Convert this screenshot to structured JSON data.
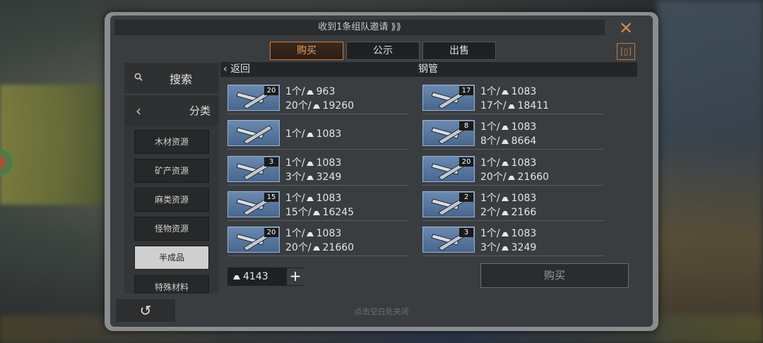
{
  "header": {
    "notification": "收到1条组队邀请 ⟫⟫",
    "close_icon": "✕"
  },
  "tabs": [
    {
      "label": "购买",
      "active": true
    },
    {
      "label": "公示",
      "active": false
    },
    {
      "label": "出售",
      "active": false
    }
  ],
  "sidebar": {
    "search_label": "搜索",
    "category_label": "分类",
    "categories": [
      {
        "label": "木材资源",
        "active": false
      },
      {
        "label": "矿产资源",
        "active": false
      },
      {
        "label": "麻类资源",
        "active": false
      },
      {
        "label": "怪物资源",
        "active": false
      },
      {
        "label": "半成品",
        "active": true
      },
      {
        "label": "特殊材料",
        "active": false
      }
    ]
  },
  "content": {
    "back_label": "返回",
    "title": "钢管"
  },
  "listings": [
    {
      "badge": "20",
      "unit": "1个/",
      "unit_price": "963",
      "qty": "20个/",
      "total": "19260"
    },
    {
      "badge": "17",
      "unit": "1个/",
      "unit_price": "1083",
      "qty": "17个/",
      "total": "18411"
    },
    {
      "badge": "",
      "unit": "1个/",
      "unit_price": "1083",
      "qty": "",
      "total": ""
    },
    {
      "badge": "8",
      "unit": "1个/",
      "unit_price": "1083",
      "qty": "8个/",
      "total": "8664"
    },
    {
      "badge": "3",
      "unit": "1个/",
      "unit_price": "1083",
      "qty": "3个/",
      "total": "3249"
    },
    {
      "badge": "20",
      "unit": "1个/",
      "unit_price": "1083",
      "qty": "20个/",
      "total": "21660"
    },
    {
      "badge": "15",
      "unit": "1个/",
      "unit_price": "1083",
      "qty": "15个/",
      "total": "16245"
    },
    {
      "badge": "2",
      "unit": "1个/",
      "unit_price": "1083",
      "qty": "2个/",
      "total": "2166"
    },
    {
      "badge": "20",
      "unit": "1个/",
      "unit_price": "1083",
      "qty": "20个/",
      "total": "21660"
    },
    {
      "badge": "3",
      "unit": "1个/",
      "unit_price": "1083",
      "qty": "3个/",
      "total": "3249"
    }
  ],
  "footer": {
    "balance": "4143",
    "plus": "+",
    "buy_label": "购买",
    "hint": "点击空白处关闭",
    "undo_icon": "↺"
  },
  "colors": {
    "accent": "#d07a38",
    "thumb_bg": "#5a7aa0"
  }
}
